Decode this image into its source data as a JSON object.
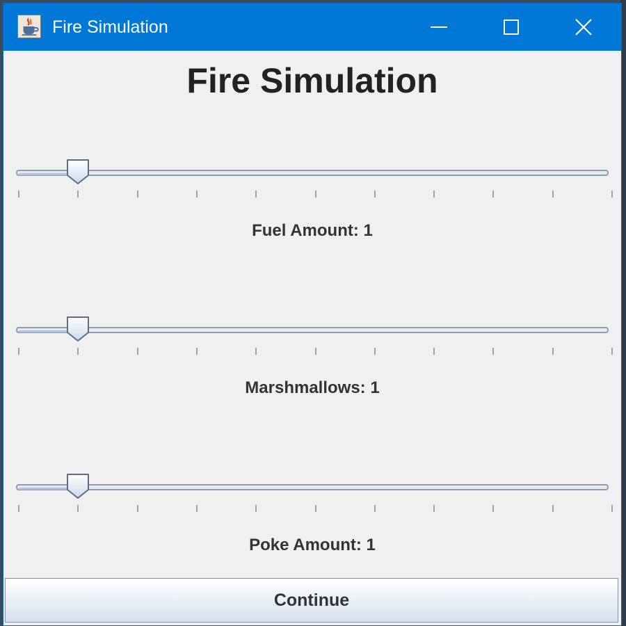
{
  "window": {
    "title": "Fire Simulation",
    "controls": [
      "minimize",
      "maximize",
      "close"
    ],
    "titlebar_color": "#0078d7"
  },
  "main": {
    "heading": "Fire Simulation",
    "sliders": [
      {
        "label": "Fuel Amount: 1",
        "value": 1,
        "min": 0,
        "max": 10
      },
      {
        "label": "Marshmallows: 1",
        "value": 1,
        "min": 0,
        "max": 10
      },
      {
        "label": "Poke Amount: 1",
        "value": 1,
        "min": 0,
        "max": 10
      }
    ],
    "continue_label": "Continue"
  },
  "icons": {
    "app": "java-cup-icon",
    "minimize": "minimize-icon",
    "maximize": "maximize-icon",
    "close": "close-icon"
  }
}
